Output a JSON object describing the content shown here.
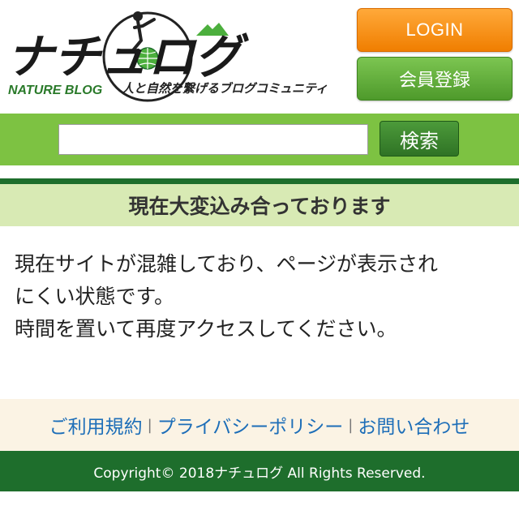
{
  "logo": {
    "main_text": "ナチュログ",
    "sub_text": "NATURE BLOG",
    "tagline": "人と自然を繋げるブログコミュニティ"
  },
  "header": {
    "login_label": "LOGIN",
    "register_label": "会員登録"
  },
  "search": {
    "input_value": "",
    "button_label": "検索"
  },
  "notice": {
    "heading": "現在大変込み合っております",
    "lines": [
      "現在サイトが混雑しており、ページが表示され",
      "にくい状態です。",
      "時間を置いて再度アクセスしてください。"
    ]
  },
  "footer": {
    "links": [
      "ご利用規約",
      "プライバシーポリシー",
      "お問い合わせ"
    ],
    "separator": "|",
    "copyright": "Copyright© 2018ナチュログ All Rights Reserved."
  },
  "colors": {
    "brand_green": "#7dc242",
    "dark_green": "#1e6e2c",
    "login_orange": "#f07e00",
    "link_blue": "#1d6eb8"
  }
}
